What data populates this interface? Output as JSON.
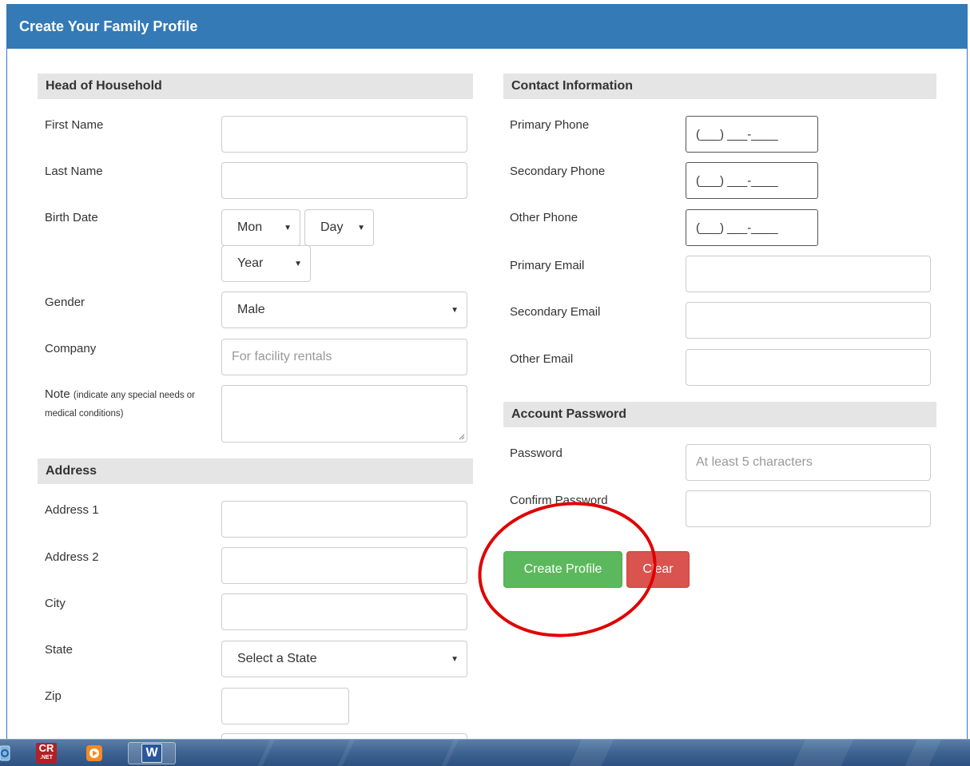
{
  "panel": {
    "title": "Create Your Family Profile"
  },
  "head_of_household": {
    "heading": "Head of Household",
    "first_name_label": "First Name",
    "last_name_label": "Last Name",
    "birth_date_label": "Birth Date",
    "birth_month": "Mon",
    "birth_day": "Day",
    "birth_year": "Year",
    "gender_label": "Gender",
    "gender_value": "Male",
    "company_label": "Company",
    "company_placeholder": "For facility rentals",
    "note_label": "Note",
    "note_hint": "(indicate any special needs or medical conditions)"
  },
  "address": {
    "heading": "Address",
    "address1_label": "Address 1",
    "address2_label": "Address 2",
    "city_label": "City",
    "state_label": "State",
    "state_value": "Select a State",
    "zip_label": "Zip"
  },
  "contact": {
    "heading": "Contact Information",
    "primary_phone_label": "Primary Phone",
    "secondary_phone_label": "Secondary Phone",
    "other_phone_label": "Other Phone",
    "phone_mask": "(___) ___-____",
    "primary_email_label": "Primary Email",
    "secondary_email_label": "Secondary Email",
    "other_email_label": "Other Email"
  },
  "account": {
    "heading": "Account Password",
    "password_label": "Password",
    "password_placeholder": "At least 5 characters",
    "confirm_label": "Confirm Password"
  },
  "buttons": {
    "create": "Create Profile",
    "clear": "Clear"
  },
  "taskbar": {
    "cr_icon_text": "CR",
    "cr_icon_sub": ".NET",
    "word_icon_text": "W"
  },
  "colors": {
    "header": "#337ab7",
    "success": "#5cb85c",
    "danger": "#d9534f",
    "annotation": "#e00000"
  },
  "icons": [
    "chevron-down-icon",
    "resize-handle-icon",
    "ie-icon",
    "crystal-reports-icon",
    "media-player-icon",
    "word-icon"
  ]
}
